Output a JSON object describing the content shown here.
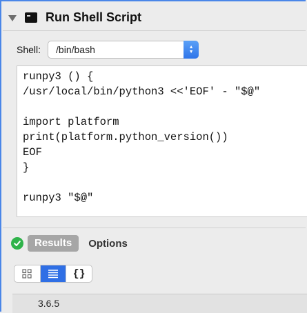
{
  "header": {
    "title": "Run Shell Script",
    "disclosure_icon": "disclosure-triangle-icon",
    "action_icon": "terminal-icon"
  },
  "shell": {
    "label": "Shell:",
    "selected": "/bin/bash"
  },
  "script": {
    "lines": [
      "runpy3 () {",
      "/usr/local/bin/python3 <<'EOF' - \"$@\"",
      "",
      "import platform",
      "print(platform.python_version())",
      "EOF",
      "}",
      "",
      "runpy3 \"$@\""
    ]
  },
  "footer_tabs": {
    "status_icon": "checkmark-circle-icon",
    "status_color": "#2fb34a",
    "results_label": "Results",
    "options_label": "Options"
  },
  "view_modes": {
    "selected": "list",
    "modes": [
      "icon-grid",
      "list",
      "braces"
    ],
    "braces_label": "{}"
  },
  "results": {
    "items": [
      "3.6.5"
    ]
  },
  "colors": {
    "accent": "#2f6fe5",
    "frame": "#4a86e8"
  }
}
